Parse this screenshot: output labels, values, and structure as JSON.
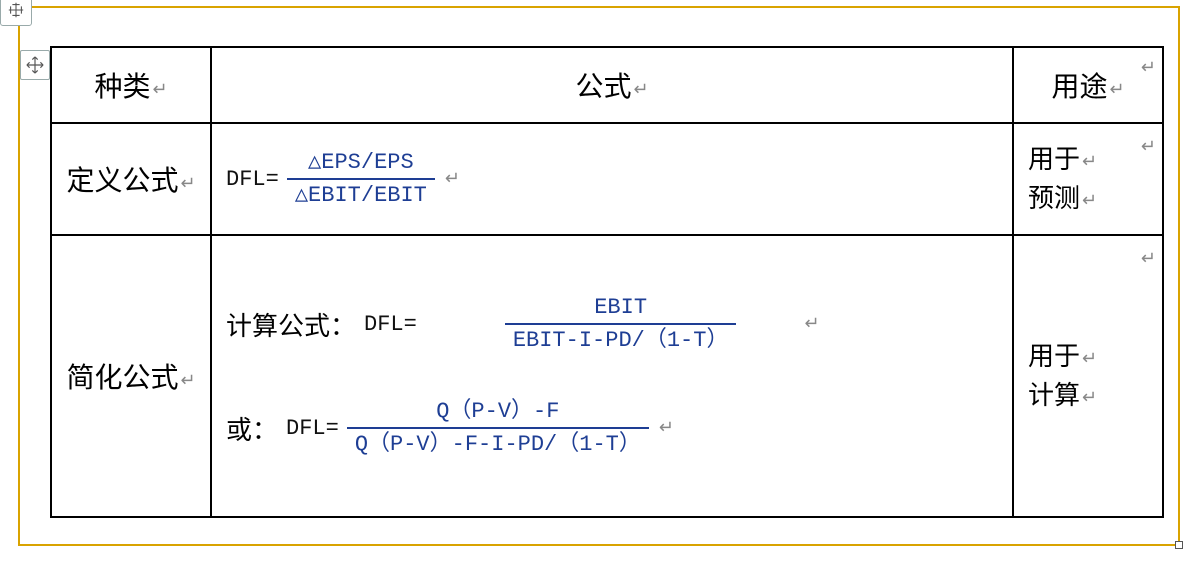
{
  "headers": {
    "col1": "种类",
    "col2": "公式",
    "col3": "用途"
  },
  "rows": {
    "definition": {
      "label": "定义公式",
      "formula": {
        "lhs": "DFL=",
        "numerator": "△EPS/EPS",
        "denominator": "△EBIT/EBIT"
      },
      "usage_line1": "用于",
      "usage_line2": "预测"
    },
    "simplified": {
      "label": "简化公式",
      "formula1": {
        "prefix": "计算公式：",
        "lhs": "DFL=",
        "numerator": "EBIT",
        "denominator": "EBIT-I-PD/（1-T）"
      },
      "formula2": {
        "prefix": "或：",
        "lhs": "DFL=",
        "numerator": "Q（P-V）-F",
        "denominator": "Q（P-V）-F-I-PD/（1-T）"
      },
      "usage_line1": "用于",
      "usage_line2": "计算"
    }
  },
  "glyphs": {
    "return": "↵"
  }
}
